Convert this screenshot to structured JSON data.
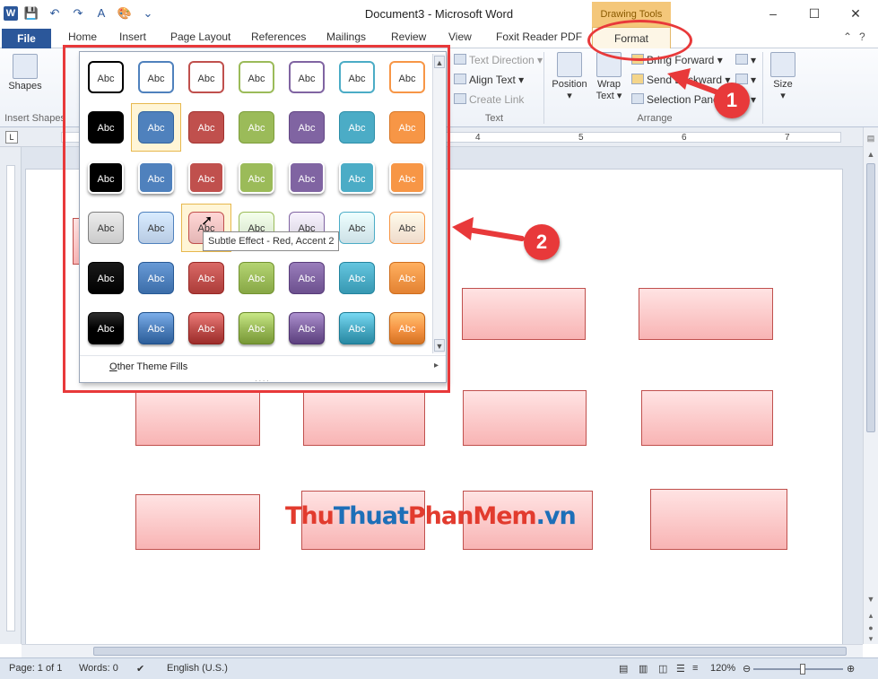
{
  "window": {
    "title": "Document3  -  Microsoft Word",
    "context_tab_group": "Drawing Tools"
  },
  "qat": [
    {
      "name": "save-icon",
      "glyph": "💾"
    },
    {
      "name": "undo-icon",
      "glyph": "↶"
    },
    {
      "name": "redo-icon",
      "glyph": "↷"
    },
    {
      "name": "text-style-icon",
      "glyph": "A"
    },
    {
      "name": "paint-icon",
      "glyph": "🎨"
    },
    {
      "name": "customize-qat-icon",
      "glyph": "⌄"
    }
  ],
  "window_controls": {
    "minimize": "–",
    "maximize": "☐",
    "close": "✕"
  },
  "tabs": {
    "file": "File",
    "items": [
      {
        "label": "Home"
      },
      {
        "label": "Insert"
      },
      {
        "label": "Page Layout"
      },
      {
        "label": "References"
      },
      {
        "label": "Mailings"
      },
      {
        "label": "Review"
      },
      {
        "label": "View"
      },
      {
        "label": "Foxit Reader PDF"
      }
    ],
    "format": "Format"
  },
  "ribbon": {
    "shapes_label": "Shapes",
    "insert_shapes_label": "Insert Shapes",
    "text_direction": "Text Direction",
    "align_text": "Align Text",
    "create_link": "Create Link",
    "text_group": "Text",
    "position": "Position",
    "wrap_text_1": "Wrap",
    "wrap_text_2": "Text",
    "bring_forward": "Bring Forward",
    "send_backward": "Send Backward",
    "selection_pane": "Selection Pane",
    "arrange_group": "Arrange",
    "size": "Size"
  },
  "ruler": {
    "numbers": [
      "4",
      "5",
      "6",
      "7"
    ]
  },
  "gallery": {
    "swatch_text": "Abc",
    "theme_colors": [
      "#000000",
      "#4f81bd",
      "#c0504d",
      "#9bbb59",
      "#8064a2",
      "#4bacc6",
      "#f79646"
    ],
    "moderate_colors": [
      "#7f7f7f",
      "#4f81bd",
      "#c0504d",
      "#9bbb59",
      "#8064a2",
      "#4bacc6",
      "#f79646"
    ],
    "light_fills": [
      "#d9d9d9",
      "#c6d9f1",
      "#f2c4c3",
      "#e2efd9",
      "#e5e0ec",
      "#dbeef4",
      "#fde9d9"
    ],
    "other_fills_label_prefix": "O",
    "other_fills_label_rest": "ther Theme Fills",
    "tooltip": "Subtle Effect - Red, Accent 2"
  },
  "status": {
    "page": "Page: 1 of 1",
    "words": "Words: 0",
    "language": "English (U.S.)",
    "zoom": "120%"
  },
  "annotations": {
    "badge1": "1",
    "badge2": "2"
  },
  "watermark": {
    "part1": "Thu",
    "part2": "Thuat",
    "part3": "PhanMem",
    "part4": ".vn"
  },
  "colors": {
    "accent": "#2b579a",
    "annotation": "#e8393a",
    "shape_fill": "#f8b4b4",
    "shape_border": "#c0504d"
  }
}
